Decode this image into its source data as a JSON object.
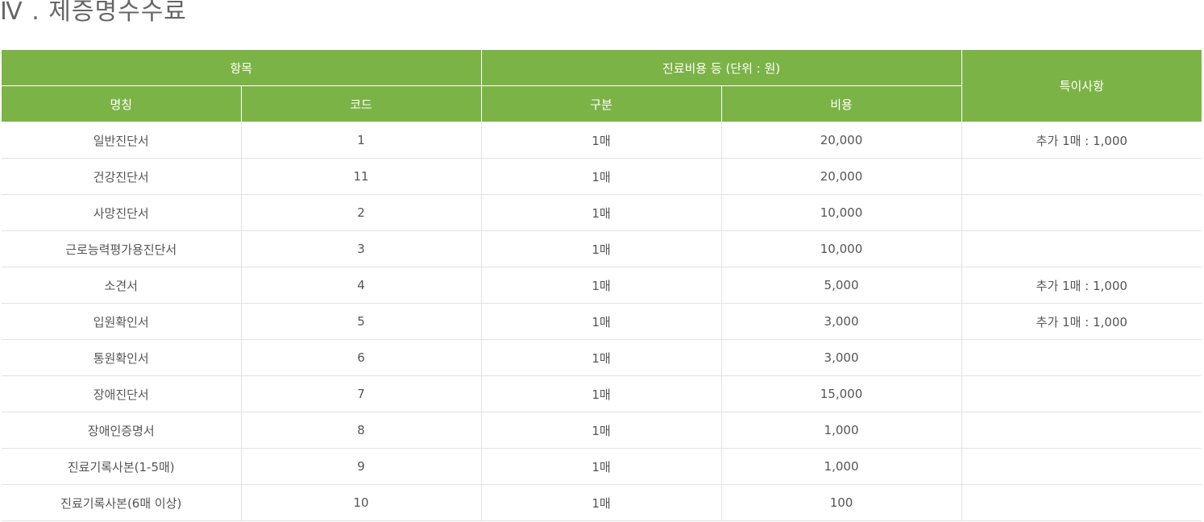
{
  "title": "Ⅳ . 제증명수수료",
  "table": {
    "header_group": {
      "item": "항목",
      "cost": "진료비용 등 (단위 : 원)",
      "note": "특이사항"
    },
    "header_sub": {
      "name": "명칭",
      "code": "코드",
      "type": "구분",
      "cost": "비용"
    },
    "rows": [
      {
        "name": "일반진단서",
        "code": "1",
        "type": "1매",
        "cost": "20,000",
        "note": "추가 1매 : 1,000"
      },
      {
        "name": "건강진단서",
        "code": "11",
        "type": "1매",
        "cost": "20,000",
        "note": ""
      },
      {
        "name": "사망진단서",
        "code": "2",
        "type": "1매",
        "cost": "10,000",
        "note": ""
      },
      {
        "name": "근로능력평가용진단서",
        "code": "3",
        "type": "1매",
        "cost": "10,000",
        "note": ""
      },
      {
        "name": "소견서",
        "code": "4",
        "type": "1매",
        "cost": "5,000",
        "note": "추가 1매 : 1,000"
      },
      {
        "name": "입원확인서",
        "code": "5",
        "type": "1매",
        "cost": "3,000",
        "note": "추가 1매 : 1,000"
      },
      {
        "name": "통원확인서",
        "code": "6",
        "type": "1매",
        "cost": "3,000",
        "note": ""
      },
      {
        "name": "장애진단서",
        "code": "7",
        "type": "1매",
        "cost": "15,000",
        "note": ""
      },
      {
        "name": "장애인증명서",
        "code": "8",
        "type": "1매",
        "cost": "1,000",
        "note": ""
      },
      {
        "name": "진료기록사본(1-5매)",
        "code": "9",
        "type": "1매",
        "cost": "1,000",
        "note": ""
      },
      {
        "name": "진료기록사본(6매 이상)",
        "code": "10",
        "type": "1매",
        "cost": "100",
        "note": ""
      }
    ]
  },
  "colors": {
    "header_bg": "#7cb347",
    "border": "#e2e2e2",
    "text": "#555555"
  }
}
